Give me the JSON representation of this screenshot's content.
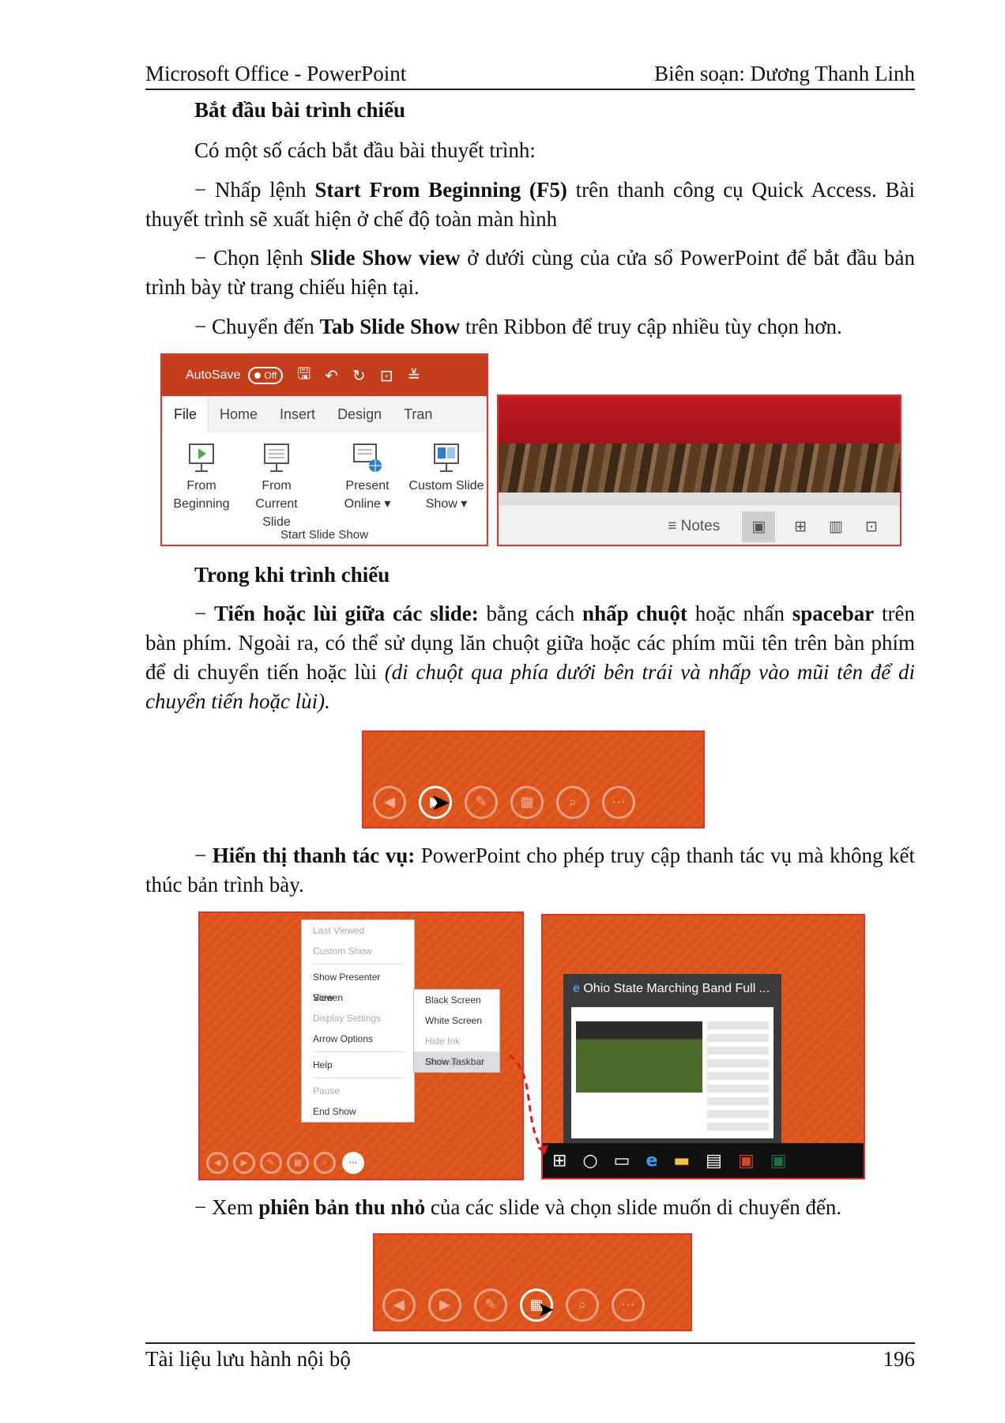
{
  "header": {
    "left": "Microsoft Office - PowerPoint",
    "right": "Biên soạn: Dương Thanh Linh"
  },
  "section1": {
    "heading": "Bắt đầu bài trình chiếu",
    "intro": "Có một số cách bắt đầu bài thuyết trình:",
    "item1_pre": "− Nhấp lệnh ",
    "item1_bold": "Start From Beginning (F5)",
    "item1_post": " trên thanh công cụ Quick Access. Bài thuyết trình sẽ xuất hiện ở chế độ toàn màn hình",
    "item2_pre": "− Chọn lệnh ",
    "item2_bold": "Slide Show view",
    "item2_post": " ở dưới cùng của cửa sổ PowerPoint để bắt đầu bản trình bày từ trang chiếu hiện tại.",
    "item3_pre": "− Chuyển đến ",
    "item3_bold": "Tab Slide Show",
    "item3_post": " trên Ribbon để truy cập nhiều tùy chọn hơn."
  },
  "ribbon": {
    "autosave": "AutoSave",
    "toggle": "Off",
    "tabs": [
      "File",
      "Home",
      "Insert",
      "Design",
      "Tran"
    ],
    "buttons": [
      {
        "line1": "From",
        "line2": "Beginning"
      },
      {
        "line1": "From",
        "line2": "Current Slide"
      },
      {
        "line1": "Present",
        "line2": "Online ▾"
      },
      {
        "line1": "Custom Slide",
        "line2": "Show ▾"
      }
    ],
    "group": "Start Slide Show"
  },
  "statusbar": {
    "notes": "≡ Notes"
  },
  "section2": {
    "heading": "Trong khi trình chiếu",
    "p1_pre": "− ",
    "p1_bold1": "Tiến hoặc lùi giữa các slide:",
    "p1_mid1": " bằng cách ",
    "p1_bold2": "nhấp chuột",
    "p1_mid2": " hoặc nhấn ",
    "p1_bold3": "spacebar",
    "p1_mid3": " trên bàn phím. Ngoài ra, có thể sử dụng lăn chuột giữa hoặc các phím mũi tên trên bàn phím để di chuyển tiến hoặc lùi ",
    "p1_italic": "(di chuột qua phía dưới bên trái và nhấp vào mũi tên để di chuyển tiến hoặc lùi).",
    "p2_pre": "− ",
    "p2_bold": "Hiển thị thanh tác vụ:",
    "p2_post": " PowerPoint cho phép truy cập thanh tác vụ mà không kết thúc bản trình bày.",
    "p3_pre": "− Xem ",
    "p3_bold": "phiên bản thu nhỏ",
    "p3_post": " của các slide và chọn slide muốn di chuyển đến."
  },
  "context_menu": {
    "items": [
      "Last Viewed",
      "Custom Show",
      "Show Presenter View",
      "Screen",
      "Display Settings",
      "Arrow Options",
      "Help",
      "Pause",
      "End Show"
    ],
    "submenu": [
      "Black Screen",
      "White Screen",
      "Hide Ink Markup",
      "Show Taskbar"
    ]
  },
  "browser_preview": {
    "title": "Ohio State Marching Band Full ..."
  },
  "footer": {
    "left": "Tài liệu lưu hành nội bộ",
    "page": "196"
  }
}
